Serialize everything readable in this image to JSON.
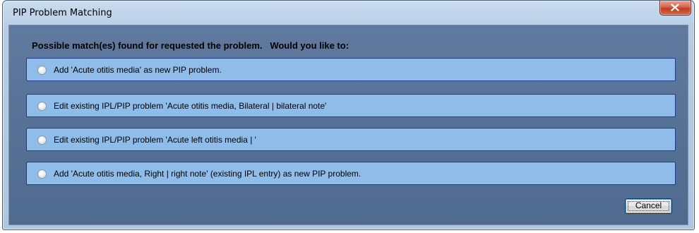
{
  "window": {
    "title": "PIP Problem Matching"
  },
  "dialog": {
    "prompt": "Possible match(es) found for requested the problem.   Would you like to:",
    "options": [
      {
        "label": "Add 'Acute otitis media' as new PIP problem."
      },
      {
        "label": "Edit existing IPL/PIP problem 'Acute otitis media, Bilateral | bilateral note'"
      },
      {
        "label": "Edit existing IPL/PIP problem 'Acute left otitis media | '"
      },
      {
        "label": "Add 'Acute otitis media, Right | right note' (existing IPL entry) as new PIP problem."
      }
    ],
    "cancel_label": "Cancel"
  },
  "icons": {
    "close": "close-icon"
  },
  "colors": {
    "option_background": "#8fbce8",
    "option_border": "#1f3a8a",
    "client_background": "#5f7a9e",
    "close_button": "#c23b1f"
  }
}
